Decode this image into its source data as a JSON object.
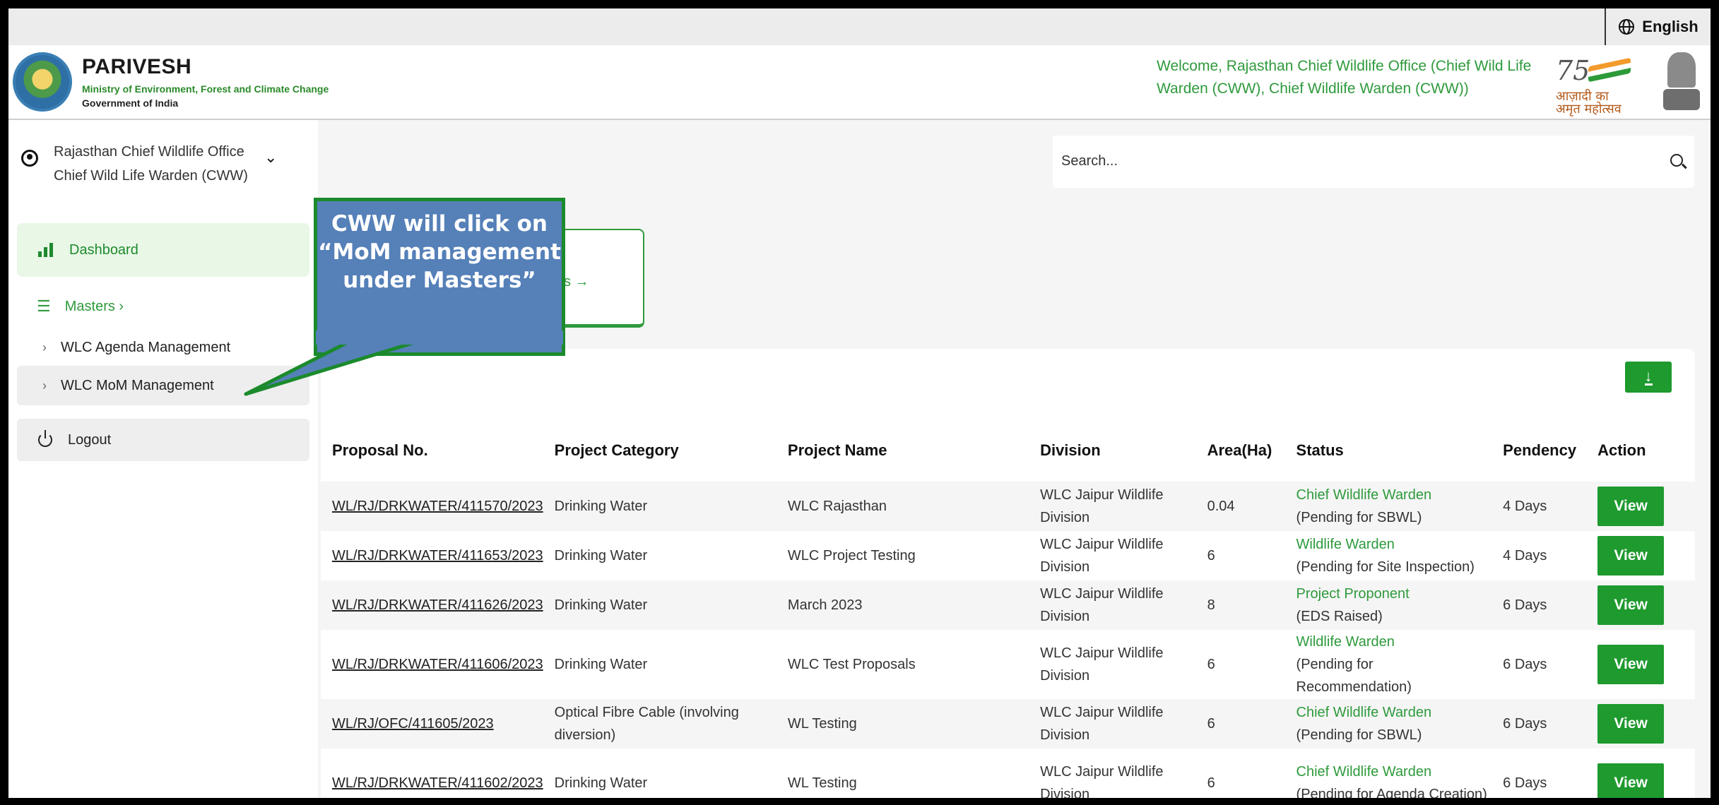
{
  "lang": {
    "label": "English"
  },
  "brand": {
    "title": "PARIVESH",
    "ministry": "Ministry of Environment, Forest and Climate Change",
    "gov": "Government of India"
  },
  "welcome": "Welcome, Rajasthan Chief Wildlife Office (Chief Wild Life Warden (CWW), Chief Wildlife Warden (CWW))",
  "azadi": {
    "num": "75",
    "line1": "आज़ादी का",
    "line2": "अमृत महोत्सव"
  },
  "sidebar": {
    "user_line1": "Rajasthan Chief Wildlife Office",
    "user_line2": "Chief Wild Life Warden (CWW)",
    "dashboard": "Dashboard",
    "masters": "Masters",
    "masters_chev": "›",
    "agenda": "WLC Agenda Management",
    "mom": "WLC MoM Management",
    "logout": "Logout"
  },
  "search": {
    "placeholder": "Search..."
  },
  "card": {
    "link": "s →"
  },
  "table": {
    "headers": [
      "Proposal No.",
      "Project Category",
      "Project Name",
      "Division",
      "Area(Ha)",
      "Status",
      "Pendency",
      "Action"
    ],
    "rows": [
      {
        "pno": "WL/RJ/DRKWATER/411570/2023",
        "category": "Drinking Water",
        "name": "WLC Rajasthan",
        "division": "WLC Jaipur Wildlife Division",
        "area": "0.04",
        "status_role": "Chief Wildlife Warden",
        "status_note": "(Pending for SBWL)",
        "pendency": "4 Days",
        "action": "View"
      },
      {
        "pno": "WL/RJ/DRKWATER/411653/2023",
        "category": "Drinking Water",
        "name": "WLC Project Testing",
        "division": "WLC Jaipur Wildlife Division",
        "area": "6",
        "status_role": "Wildlife Warden",
        "status_note": "(Pending for Site Inspection)",
        "pendency": "4 Days",
        "action": "View"
      },
      {
        "pno": "WL/RJ/DRKWATER/411626/2023",
        "category": "Drinking Water",
        "name": "March 2023",
        "division": "WLC Jaipur Wildlife Division",
        "area": "8",
        "status_role": "Project Proponent",
        "status_note": "(EDS Raised)",
        "pendency": "6 Days",
        "action": "View"
      },
      {
        "pno": "WL/RJ/DRKWATER/411606/2023",
        "category": "Drinking Water",
        "name": "WLC Test Proposals",
        "division": "WLC Jaipur Wildlife Division",
        "area": "6",
        "status_role": "Wildlife Warden",
        "status_note": "(Pending for Recommendation)",
        "pendency": "6 Days",
        "action": "View"
      },
      {
        "pno": "WL/RJ/OFC/411605/2023",
        "category": "Optical Fibre Cable (involving diversion)",
        "name": "WL Testing",
        "division": "WLC Jaipur Wildlife Division",
        "area": "6",
        "status_role": "Chief Wildlife Warden",
        "status_note": "(Pending for SBWL)",
        "pendency": "6 Days",
        "action": "View"
      },
      {
        "pno": "WL/RJ/DRKWATER/411602/2023",
        "category": "Drinking Water",
        "name": "WL Testing",
        "division": "WLC Jaipur Wildlife Division",
        "area": "6",
        "status_role": "Chief Wildlife Warden",
        "status_note": "(Pending for Agenda Creation)",
        "pendency": "6 Days",
        "action": "View"
      }
    ]
  },
  "callout": {
    "text": "CWW will click on “MoM management under Masters”"
  }
}
